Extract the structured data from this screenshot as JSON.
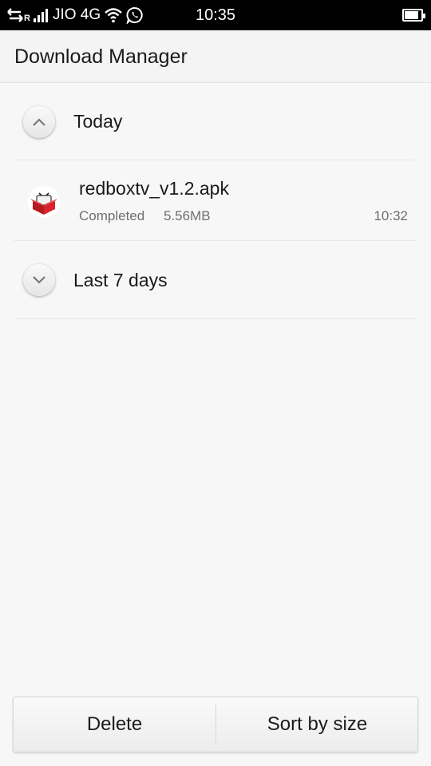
{
  "status_bar": {
    "carrier": "JIO 4G",
    "roaming": "R",
    "time": "10:35",
    "icons": [
      "data-transfer-icon",
      "signal-icon",
      "wifi-icon",
      "whatsapp-icon",
      "battery-icon"
    ],
    "battery_level": 0.85
  },
  "header": {
    "title": "Download Manager"
  },
  "groups": [
    {
      "label": "Today",
      "expanded": true,
      "items": [
        {
          "name": "redboxtv_v1.2.apk",
          "status": "Completed",
          "size": "5.56MB",
          "time": "10:32",
          "icon": "redbox-tv-app-icon"
        }
      ]
    },
    {
      "label": "Last 7 days",
      "expanded": false,
      "items": []
    }
  ],
  "bottom_bar": {
    "delete_label": "Delete",
    "sort_label": "Sort by size"
  },
  "colors": {
    "status_bar_bg": "#000000",
    "background": "#f7f7f7",
    "secondary_text": "#6e6e6e",
    "icon_red": "#d9232d"
  }
}
